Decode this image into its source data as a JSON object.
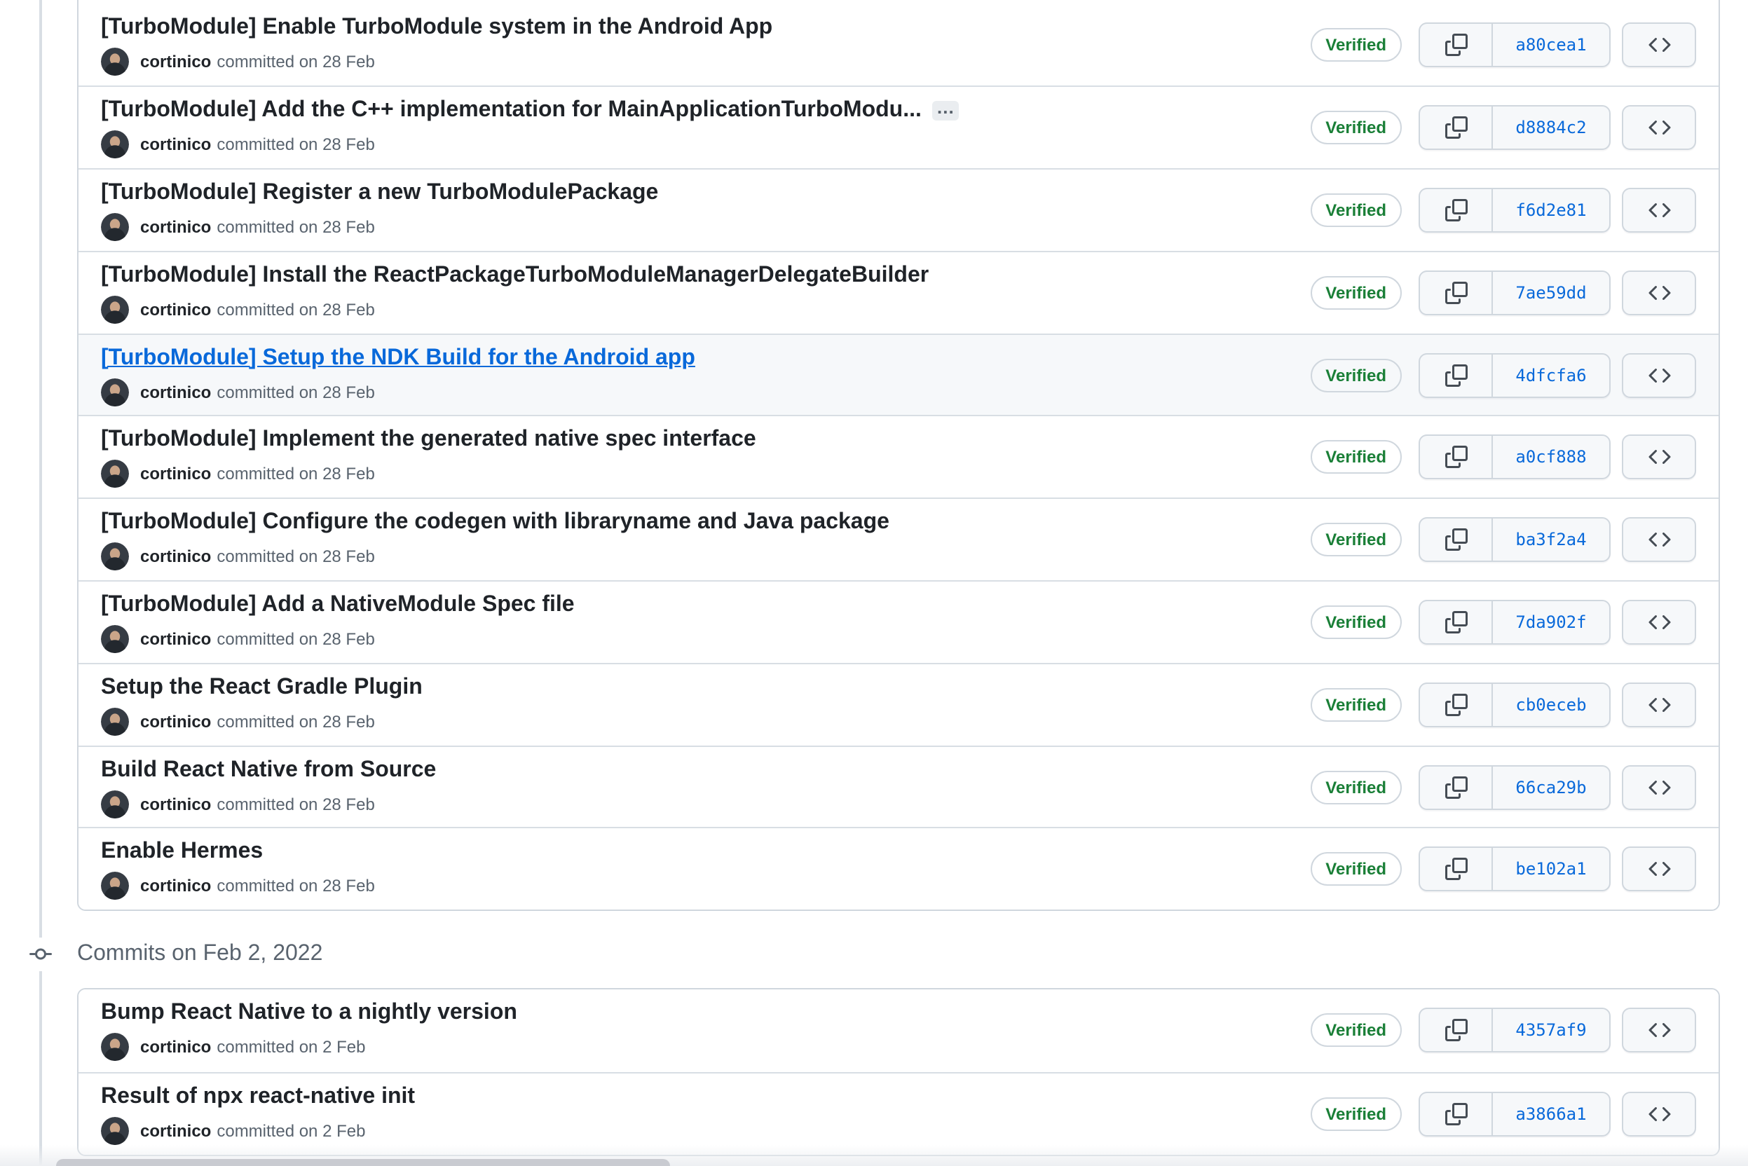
{
  "heading_feb2": "Commits on Feb 2, 2022",
  "labels": {
    "verified": "Verified",
    "ellipsis": "…"
  },
  "commits": [
    {
      "title": "[TurboModule] Enable TurboModule system in the Android App",
      "author": "cortinico",
      "action": "committed on 28 Feb",
      "sha": "a80cea1",
      "badge": "Verified"
    },
    {
      "title": "[TurboModule] Add the C++ implementation for MainApplicationTurboModu...",
      "author": "cortinico",
      "action": "committed on 28 Feb",
      "sha": "d8884c2",
      "badge": "Verified"
    },
    {
      "title": "[TurboModule] Register a new TurboModulePackage",
      "author": "cortinico",
      "action": "committed on 28 Feb",
      "sha": "f6d2e81",
      "badge": "Verified"
    },
    {
      "title": "[TurboModule] Install the ReactPackageTurboModuleManagerDelegateBuilder",
      "author": "cortinico",
      "action": "committed on 28 Feb",
      "sha": "7ae59dd",
      "badge": "Verified"
    },
    {
      "title": "[TurboModule] Setup the NDK Build for the Android app",
      "author": "cortinico",
      "action": "committed on 28 Feb",
      "sha": "4dfcfa6",
      "badge": "Verified"
    },
    {
      "title": "[TurboModule] Implement the generated native spec interface",
      "author": "cortinico",
      "action": "committed on 28 Feb",
      "sha": "a0cf888",
      "badge": "Verified"
    },
    {
      "title": "[TurboModule] Configure the codegen with libraryname and Java package",
      "author": "cortinico",
      "action": "committed on 28 Feb",
      "sha": "ba3f2a4",
      "badge": "Verified"
    },
    {
      "title": "[TurboModule] Add a NativeModule Spec file",
      "author": "cortinico",
      "action": "committed on 28 Feb",
      "sha": "7da902f",
      "badge": "Verified"
    },
    {
      "title": "Setup the React Gradle Plugin",
      "author": "cortinico",
      "action": "committed on 28 Feb",
      "sha": "cb0eceb",
      "badge": "Verified"
    },
    {
      "title": "Build React Native from Source",
      "author": "cortinico",
      "action": "committed on 28 Feb",
      "sha": "66ca29b",
      "badge": "Verified"
    },
    {
      "title": "Enable Hermes",
      "author": "cortinico",
      "action": "committed on 28 Feb",
      "sha": "be102a1",
      "badge": "Verified"
    },
    {
      "title": "Bump React Native to a nightly version",
      "author": "cortinico",
      "action": "committed on 2 Feb",
      "sha": "4357af9",
      "badge": "Verified"
    },
    {
      "title": "Result of npx react-native init",
      "author": "cortinico",
      "action": "committed on 2 Feb",
      "sha": "a3866a1",
      "badge": "Verified"
    }
  ],
  "colors": {
    "accent_blue": "#0969da",
    "success_green": "#1a7f37",
    "title_fg": "#1f2328",
    "muted_fg": "#59636e",
    "border_default": "#d0d7de",
    "border_muted": "#d8dee4",
    "button_bg": "#f6f8fa",
    "row_highlight_bg": "#f6f8fa"
  }
}
